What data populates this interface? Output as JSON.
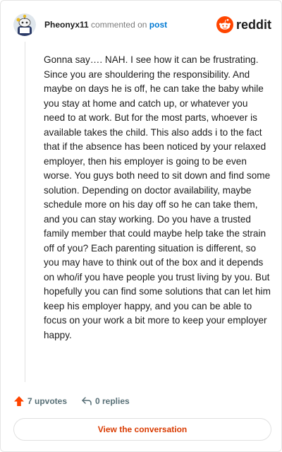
{
  "header": {
    "author": "Pheonyx11",
    "commented_on": "commented on",
    "post_link": "post",
    "brand": "reddit",
    "avatar_icon": "snoo-avatar-icon",
    "brand_icon": "reddit-logo-icon"
  },
  "comment": {
    "text": "Gonna say…. NAH. I see how it can be frustrating. Since you are shouldering the responsibility. And maybe on days he is off, he can take the baby while you stay at home and catch up, or whatever you need to at work. But for the most parts, whoever is available takes the child. This also adds i to the fact that if the absence has been noticed by your relaxed employer, then his employer is going to be even worse. You guys both need to sit down and find some solution. Depending on doctor availability, maybe schedule more on his day off so he can take them, and you can stay working. Do you have a trusted family member that could maybe help take the strain off of you? Each parenting situation is different, so you may have to think out of the box and it depends on who/if you have people you trust living by you. But hopefully you can find some solutions that can let him keep his employer happy, and you can be able to focus on your work a bit more to keep your employer happy."
  },
  "stats": {
    "upvotes": "7 upvotes",
    "replies": "0 replies",
    "upvote_icon": "upvote-arrow-icon",
    "reply_icon": "reply-arrow-icon"
  },
  "actions": {
    "view_conversation": "View the conversation"
  },
  "colors": {
    "brand_orange": "#ff4500",
    "link_blue": "#0079d3",
    "button_text": "#d93a00",
    "muted": "#576f76"
  }
}
